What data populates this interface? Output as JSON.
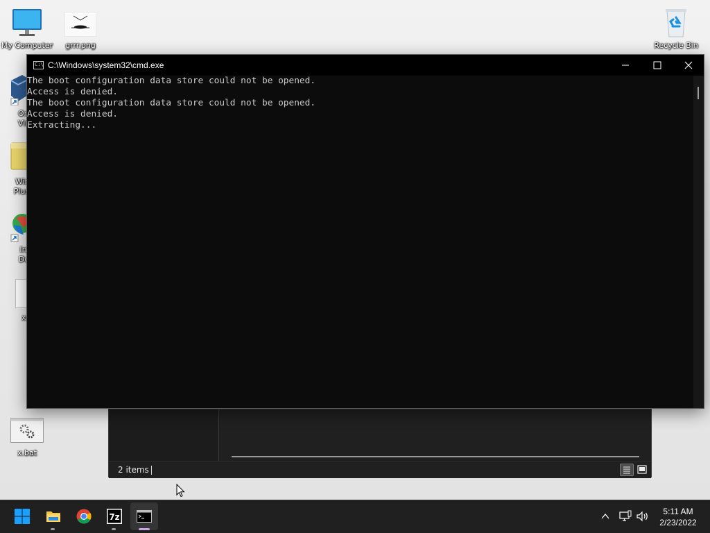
{
  "desktop": {
    "icons": [
      {
        "label": "My Computer"
      },
      {
        "label": "grrr.png"
      },
      {
        "label": "Recycle Bin"
      },
      {
        "label": "Orac",
        "label2": "Virtu"
      },
      {
        "label": "Windo",
        "label2": "Plus! H"
      },
      {
        "label": "Inte",
        "label2": "Dow"
      },
      {
        "label": "x.c"
      },
      {
        "label": "x.bat"
      }
    ]
  },
  "cmd": {
    "title": "C:\\Windows\\system32\\cmd.exe",
    "icon_text": "C:\\",
    "lines": [
      "The boot configuration data store could not be opened.",
      "Access is denied.",
      "The boot configuration data store could not be opened.",
      "Access is denied.",
      "Extracting..."
    ]
  },
  "explorer": {
    "status_count": "2 items"
  },
  "taskbar": {
    "apps": [
      {
        "name": "start",
        "icon": "windows-logo-icon"
      },
      {
        "name": "file-explorer",
        "icon": "folder-icon"
      },
      {
        "name": "chrome",
        "icon": "chrome-icon"
      },
      {
        "name": "7zip",
        "icon": "7zip-icon",
        "icon_text": "7z"
      },
      {
        "name": "cmd",
        "icon": "terminal-icon"
      }
    ],
    "tray": {
      "time": "5:11 AM",
      "date": "2/23/2022"
    }
  },
  "colors": {
    "console_bg": "#0c0c0c",
    "console_text": "#cccccc",
    "taskbar_bg": "#202020",
    "active_indicator": "#c7a3e8"
  }
}
